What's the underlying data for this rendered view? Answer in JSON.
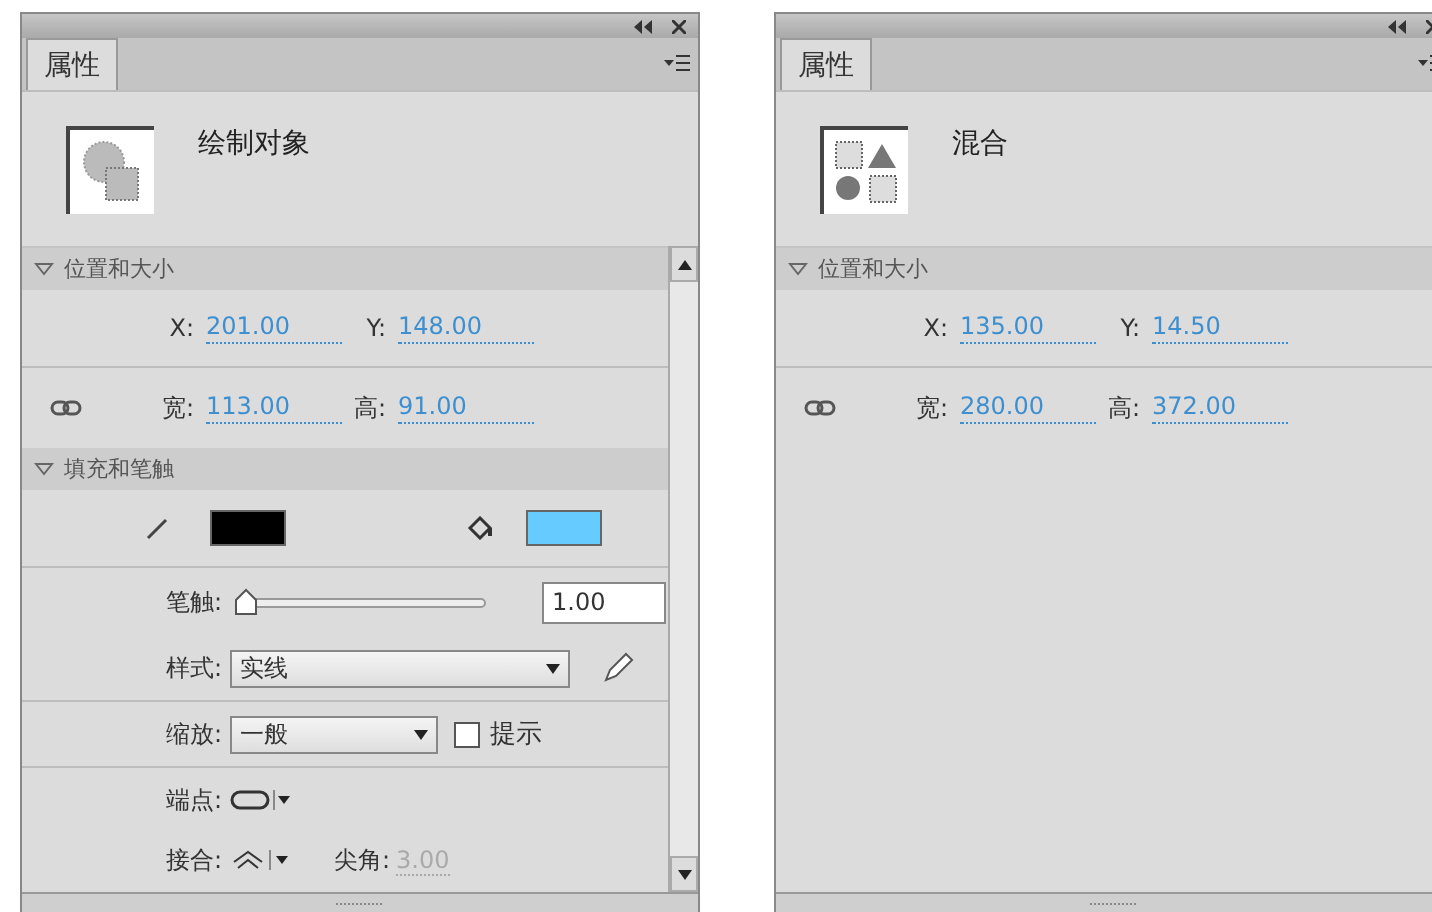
{
  "panels": [
    {
      "tab": {
        "label": "属性",
        "selected": true
      },
      "object_name": "绘制对象",
      "thumbnail": {
        "kind": "shape"
      },
      "scrollbar": true,
      "sections": [
        {
          "title": "位置和大小",
          "expanded": true,
          "rows": [
            {
              "kind": "fields",
              "link_icon": false,
              "fields": [
                {
                  "label": "X:",
                  "value": "201.00"
                },
                {
                  "label": "Y:",
                  "value": "148.00"
                }
              ]
            },
            {
              "kind": "fields",
              "link_icon": true,
              "fields": [
                {
                  "label": "宽:",
                  "value": "113.00"
                },
                {
                  "label": "高:",
                  "value": "91.00"
                }
              ]
            }
          ]
        },
        {
          "title": "填充和笔触",
          "expanded": true,
          "rows": [
            {
              "kind": "colors",
              "swatches": [
                {
                  "kind": "stroke",
                  "color": "#000000"
                },
                {
                  "kind": "fill",
                  "color": "#66ccff"
                }
              ]
            },
            {
              "kind": "slider",
              "label": "笔触:",
              "level": 0,
              "value": "1.00"
            },
            {
              "kind": "select",
              "label": "样式:",
              "value": "实线",
              "edit_icon": true
            },
            {
              "kind": "select_check",
              "label": "缩放:",
              "value": "一般",
              "checkbox": {
                "label": "提示",
                "checked": false
              }
            },
            {
              "kind": "cap",
              "label": "端点:"
            },
            {
              "kind": "join",
              "label": "接合:",
              "extra_label": "尖角:",
              "extra_value": "3.00",
              "extra_disabled": true
            }
          ]
        }
      ]
    },
    {
      "tab": {
        "label": "属性",
        "selected": true
      },
      "object_name": "混合",
      "thumbnail": {
        "kind": "blend"
      },
      "scrollbar": false,
      "sections": [
        {
          "title": "位置和大小",
          "expanded": true,
          "rows": [
            {
              "kind": "fields",
              "link_icon": false,
              "fields": [
                {
                  "label": "X:",
                  "value": "135.00"
                },
                {
                  "label": "Y:",
                  "value": "14.50"
                }
              ]
            },
            {
              "kind": "fields",
              "link_icon": true,
              "fields": [
                {
                  "label": "宽:",
                  "value": "280.00"
                },
                {
                  "label": "高:",
                  "value": "372.00"
                }
              ]
            }
          ]
        }
      ]
    }
  ]
}
